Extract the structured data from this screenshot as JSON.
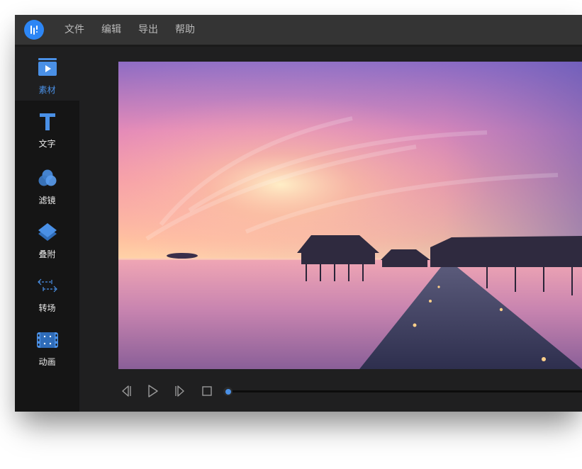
{
  "menubar": {
    "logo_icon": "app-logo-icon",
    "items": [
      "文件",
      "编辑",
      "导出",
      "帮助"
    ]
  },
  "sidebar": {
    "active_index": 0,
    "items": [
      {
        "label": "素材",
        "icon": "media-icon"
      },
      {
        "label": "文字",
        "icon": "text-icon"
      },
      {
        "label": "滤镜",
        "icon": "filter-icon"
      },
      {
        "label": "叠附",
        "icon": "overlay-icon"
      },
      {
        "label": "转场",
        "icon": "transition-icon"
      },
      {
        "label": "动画",
        "icon": "animation-icon"
      }
    ]
  },
  "player": {
    "preview": "sunset-water-villa-image",
    "controls": [
      "previous-frame-icon",
      "play-icon",
      "next-frame-icon",
      "stop-icon"
    ],
    "progress": 0.0
  },
  "colors": {
    "accent": "#4a90e6",
    "menubar": "#343434",
    "sidebar": "#151515",
    "window": "#1f1f20"
  }
}
